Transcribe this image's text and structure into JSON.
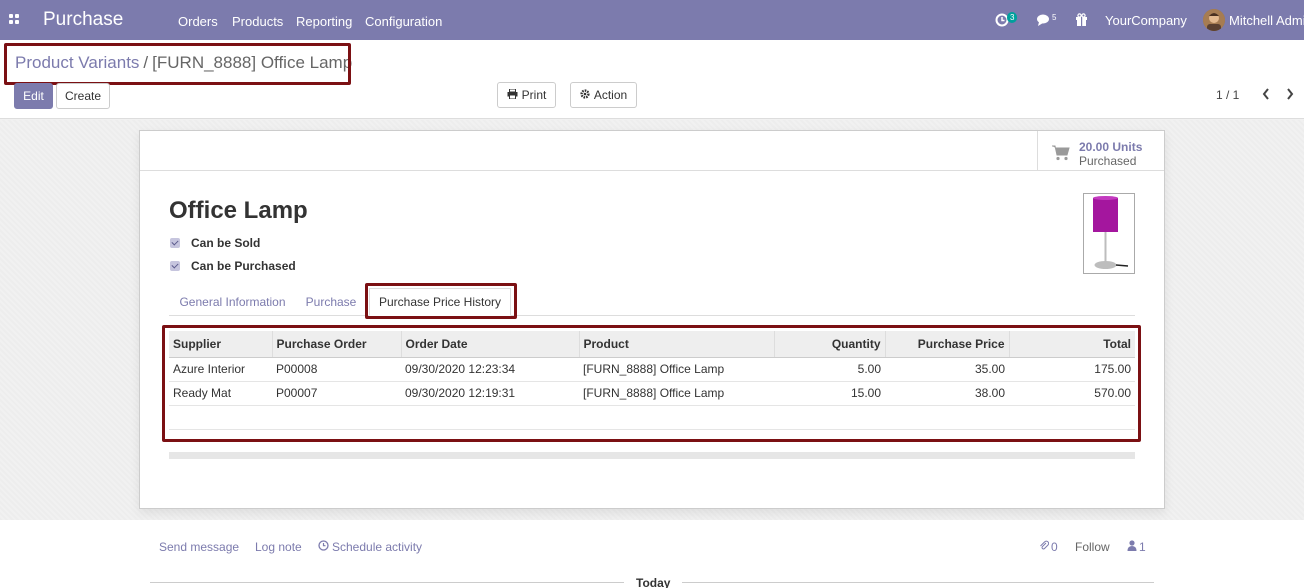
{
  "navbar": {
    "app_name": "Purchase",
    "menu": [
      "Orders",
      "Products",
      "Reporting",
      "Configuration"
    ],
    "activity_count": "3",
    "message_count": "5",
    "company": "YourCompany",
    "user": "Mitchell Admin"
  },
  "breadcrumb": {
    "parent": "Product Variants",
    "separator": "/",
    "current": "[FURN_8888] Office Lamp"
  },
  "actions": {
    "edit": "Edit",
    "create": "Create",
    "print": "Print",
    "action": "Action"
  },
  "pager": {
    "value": "1 / 1"
  },
  "stat": {
    "value": "20.00 Units",
    "label": "Purchased"
  },
  "product": {
    "name": "Office Lamp",
    "can_be_sold_label": "Can be Sold",
    "can_be_purchased_label": "Can be Purchased"
  },
  "tabs": [
    "General Information",
    "Purchase",
    "Purchase Price History"
  ],
  "history": {
    "columns": [
      "Supplier",
      "Purchase Order",
      "Order Date",
      "Product",
      "Quantity",
      "Purchase Price",
      "Total"
    ],
    "rows": [
      [
        "Azure Interior",
        "P00008",
        "09/30/2020 12:23:34",
        "[FURN_8888] Office Lamp",
        "5.00",
        "35.00",
        "175.00"
      ],
      [
        "Ready Mat",
        "P00007",
        "09/30/2020 12:19:31",
        "[FURN_8888] Office Lamp",
        "15.00",
        "38.00",
        "570.00"
      ]
    ]
  },
  "chatter": {
    "send_message": "Send message",
    "log_note": "Log note",
    "schedule_activity": "Schedule activity",
    "attachments": "0",
    "follow": "Follow",
    "followers": "1",
    "today": "Today"
  },
  "colors": {
    "brand": "#7c7bad",
    "highlight": "#7b1013"
  }
}
